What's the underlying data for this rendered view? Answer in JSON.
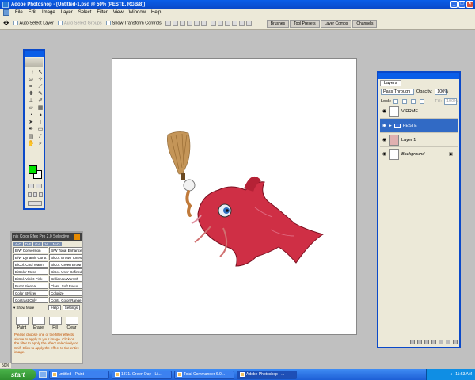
{
  "window": {
    "title": "Adobe Photoshop - [Untitled-1.psd @ 50% (PESTE, RGB/8)]"
  },
  "menu": [
    "File",
    "Edit",
    "Image",
    "Layer",
    "Select",
    "Filter",
    "View",
    "Window",
    "Help"
  ],
  "options_bar": {
    "auto_select_layer": "Auto Select Layer",
    "auto_select_groups": "Auto Select Groups",
    "show_transform_controls": "Show Transform Controls",
    "wells": [
      "Brushes",
      "Tool Presets",
      "Layer Comps",
      "Channels"
    ]
  },
  "toolbox": {
    "foreground_color": "#00e000",
    "background_color": "#ffffff"
  },
  "layers_panel": {
    "tab": "Layers",
    "blend_mode": "Pass Through",
    "opacity_label": "Opacity:",
    "opacity_value": "100%",
    "lock_label": "Lock:",
    "fill_label": "Fill:",
    "fill_value": "100%",
    "layers": [
      {
        "name": "VIERME",
        "type": "layer",
        "selected": false
      },
      {
        "name": "PESTE",
        "type": "group",
        "selected": true
      },
      {
        "name": "Layer 1",
        "type": "layer",
        "selected": false
      },
      {
        "name": "Background",
        "type": "background",
        "selected": false
      }
    ]
  },
  "color_efex": {
    "title": "nik Color Efex Pro 2.0 Selective",
    "filters": [
      [
        "B/W Conversion",
        "B/W Tonal Enhancer"
      ],
      [
        "B/W Dynamic Contr.",
        "BiCol. Brown Tones"
      ],
      [
        "BiCol. Cool Warm",
        "BiCol. Green Brown"
      ],
      [
        "BiColor Moss",
        "BiCol. User Defined"
      ],
      [
        "BiCol. Violet Pink",
        "Brilliance/Warmth"
      ],
      [
        "Burnt Sienna",
        "Class. Soft Focus"
      ],
      [
        "Color Stylizer",
        "Colorize"
      ],
      [
        "Contrast Only",
        "Contr. Color Range"
      ]
    ],
    "show_more": "Show More",
    "help": "Help",
    "settings": "Settings",
    "actions": [
      "Paint",
      "Erase",
      "Fill",
      "Clear"
    ],
    "help_text": "Please choose one of the filter effects above to apply to your image. Click on the filter to apply the effect selectively or Shift-Click to apply the effect to the entire image."
  },
  "status": {
    "zoom": "50%"
  },
  "taskbar": {
    "start": "start",
    "tasks": [
      {
        "label": "untitled - Paint",
        "active": false
      },
      {
        "label": "1871. Green Day - Li...",
        "active": false
      },
      {
        "label": "Total Commander 6.0...",
        "active": false
      },
      {
        "label": "Adobe Photoshop - ...",
        "active": true
      }
    ],
    "clock": "11:53 AM"
  }
}
